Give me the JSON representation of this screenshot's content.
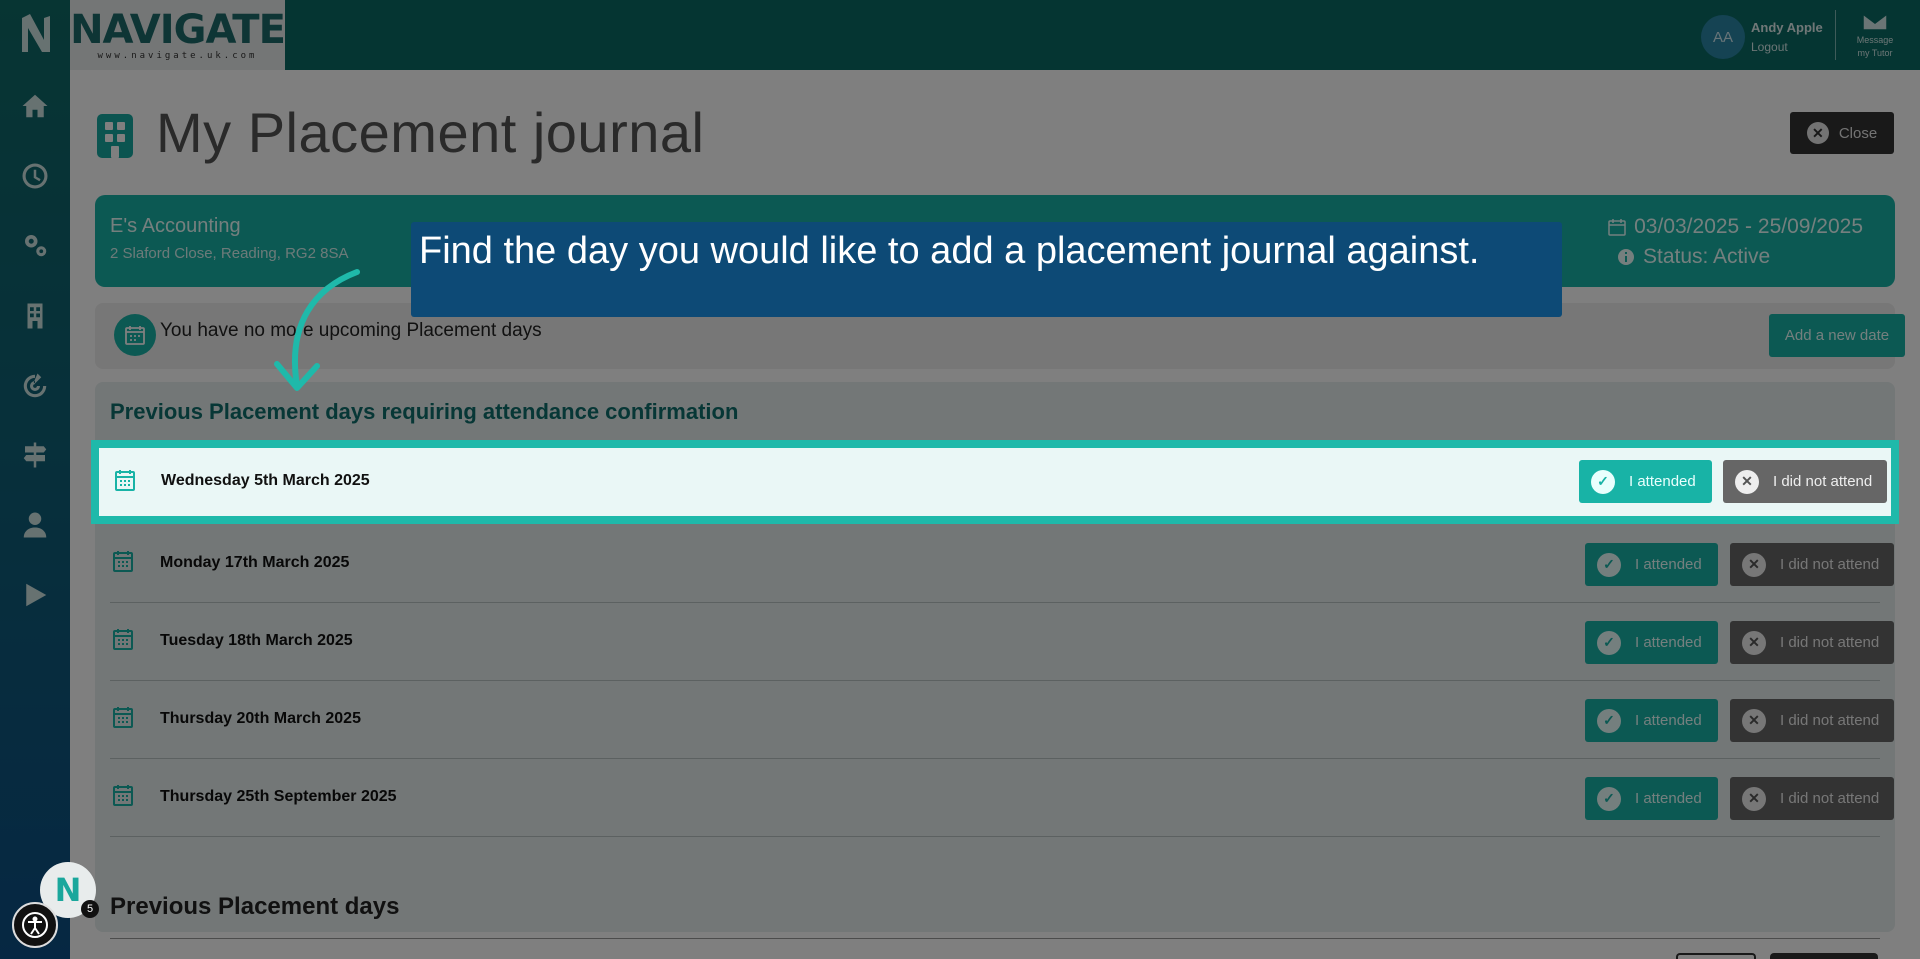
{
  "brand": {
    "name": "NAVIGATE",
    "url": "www.navigate.uk.com"
  },
  "user": {
    "initials": "AA",
    "name": "Andy Apple",
    "logout_label": "Logout",
    "message_label_line1": "Message",
    "message_label_line2": "my Tutor"
  },
  "sidebar": {
    "icons": [
      "home-icon",
      "clock-icon",
      "cogs-icon",
      "building-icon",
      "target-icon",
      "signpost-icon",
      "user-icon",
      "play-icon"
    ]
  },
  "page": {
    "title": "My Placement journal",
    "close_label": "Close"
  },
  "placement": {
    "name": "E's Accounting",
    "address": "2 Slaford Close, Reading, RG2 8SA",
    "dates": "03/03/2025 - 25/09/2025",
    "status": "Status: Active"
  },
  "upcoming": {
    "text": "You have no more upcoming Placement days",
    "add_date_label": "Add a new date"
  },
  "requiring": {
    "title": "Previous Placement days requiring attendance confirmation",
    "attended_label": "I attended",
    "not_attended_label": "I did not attend",
    "days": [
      "Wednesday 5th March 2025",
      "Monday 17th March 2025",
      "Tuesday 18th March 2025",
      "Thursday 20th March 2025",
      "Thursday 25th September 2025"
    ]
  },
  "previous": {
    "title": "Previous Placement days"
  },
  "tooltip": {
    "text": "Find the day you would like to add a placement journal against."
  },
  "notifications": {
    "count": "5",
    "badge_letter": "N"
  },
  "colors": {
    "teal": "#18b3a6",
    "dark_teal": "#0a6a65",
    "tooltip_bg": "#0d4a76",
    "highlight": "#1fb9aa"
  }
}
